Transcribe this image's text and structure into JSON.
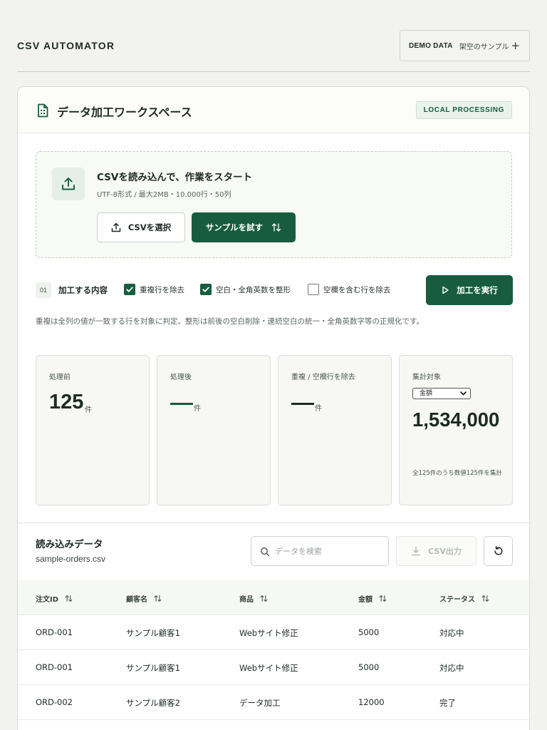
{
  "app": {
    "brand": "CSV AUTOMATOR"
  },
  "demo": {
    "tag": "DEMO DATA",
    "label": "架空のサンプル",
    "plus": "+"
  },
  "workspace": {
    "title": "データ加工ワークスペース",
    "badge": "LOCAL PROCESSING"
  },
  "upload": {
    "title": "CSVを読み込んで、作業をスタート",
    "subtitle": "UTF-8形式 / 最大2MB・10,000行・50列",
    "select_label": "CSVを選択",
    "sample_label": "サンプルを試す"
  },
  "options": {
    "step": "01",
    "title": "加工する内容",
    "items": [
      {
        "label": "重複行を除去",
        "checked": true
      },
      {
        "label": "空白・全角英数を整形",
        "checked": true
      },
      {
        "label": "空欄を含む行を除去",
        "checked": false
      }
    ],
    "run_label": "加工を実行",
    "note": "重複は全列の値が一致する行を対象に判定。整形は前後の空白削除・連続空白の統一・全角英数字等の正規化です。"
  },
  "stats": {
    "before": {
      "label": "処理前",
      "value": "125",
      "unit": "件"
    },
    "after": {
      "label": "処理後",
      "unit": "件"
    },
    "removed": {
      "label": "重複 / 空欄行を除去",
      "unit": "件"
    },
    "aggregate": {
      "label": "集計対象",
      "selected": "金額",
      "value": "1,534,000",
      "note": "全125件のうち数値125件を集計"
    }
  },
  "data": {
    "title": "読み込みデータ",
    "filename": "sample-orders.csv",
    "search_placeholder": "データを検索",
    "export_label": "CSV出力",
    "columns": [
      "注文ID",
      "顧客名",
      "商品",
      "金額",
      "ステータス"
    ],
    "rows": [
      [
        "ORD-001",
        "サンプル顧客1",
        "Webサイト修正",
        "5000",
        "対応中"
      ],
      [
        "ORD-001",
        "サンプル顧客1",
        "Webサイト修正",
        "5000",
        "対応中"
      ],
      [
        "ORD-002",
        "サンプル顧客2",
        "データ加工",
        "12000",
        "完了"
      ]
    ]
  },
  "colors": {
    "accent": "#175c3f",
    "background": "#f2f3ef",
    "card": "#ffffff",
    "badge_bg": "#e9f2ec"
  },
  "icons": {
    "document": "document-icon",
    "upload": "upload-icon",
    "sort": "sort-icon",
    "play": "play-icon",
    "search": "search-icon",
    "download": "download-icon",
    "refresh": "refresh-icon",
    "check": "checkmark-icon",
    "chevron": "chevron-down-icon"
  }
}
